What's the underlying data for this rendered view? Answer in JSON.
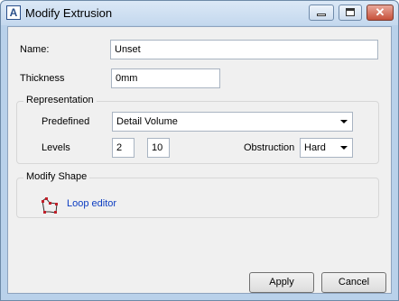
{
  "window": {
    "title": "Modify Extrusion",
    "app_icon_glyph": "A"
  },
  "fields": {
    "name_label": "Name:",
    "name_value": "Unset",
    "thickness_label": "Thickness",
    "thickness_value": "0mm"
  },
  "representation": {
    "group_label": "Representation",
    "predefined_label": "Predefined",
    "predefined_value": "Detail Volume",
    "levels_label": "Levels",
    "level_low": "2",
    "level_high": "10",
    "obstruction_label": "Obstruction",
    "obstruction_value": "Hard"
  },
  "modify_shape": {
    "group_label": "Modify Shape",
    "loop_editor_label": "Loop editor"
  },
  "buttons": {
    "apply": "Apply",
    "cancel": "Cancel"
  },
  "colors": {
    "link": "#0b3cc1",
    "loop_icon": "#c0202a"
  }
}
